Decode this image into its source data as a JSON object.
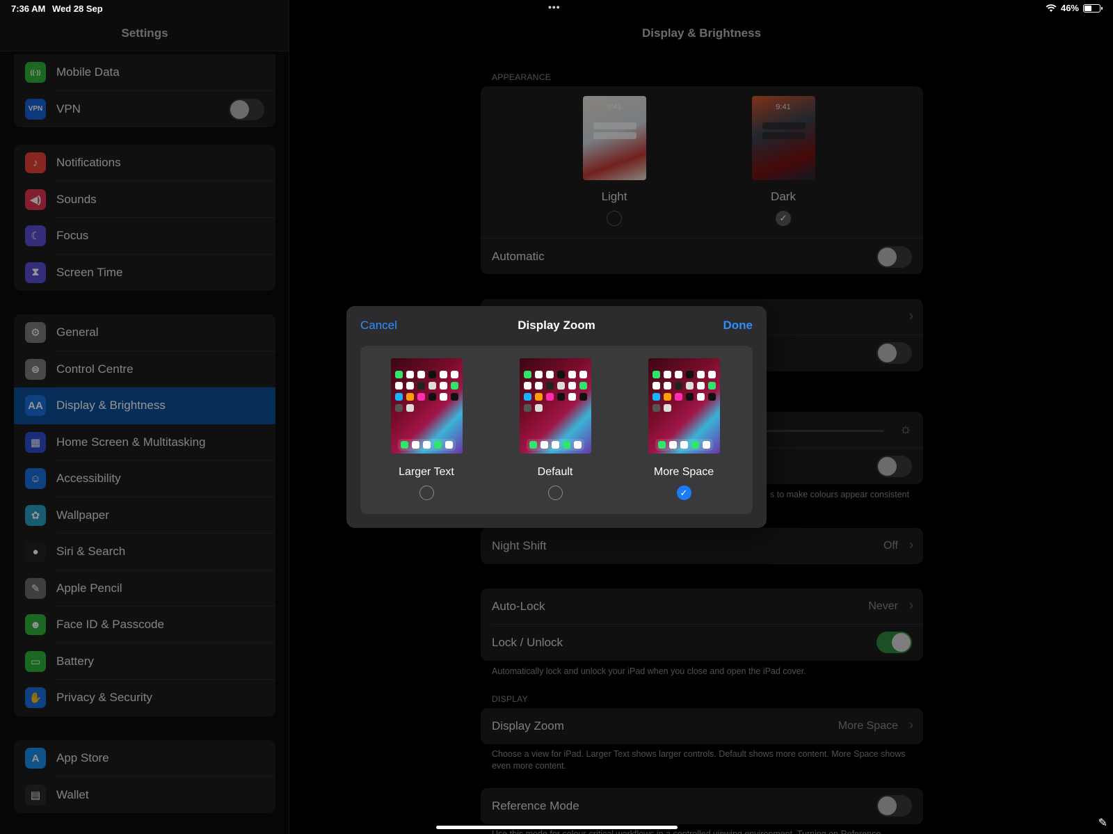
{
  "status": {
    "time": "7:36 AM",
    "date": "Wed 28 Sep",
    "battery": "46%",
    "battery_level": 0.46
  },
  "sidebar": {
    "title": "Settings",
    "groups": [
      [
        {
          "label": "Mobile Data",
          "icon": "antenna-icon",
          "color": "#30b33c"
        },
        {
          "label": "VPN",
          "icon": "vpn-icon",
          "color": "#1863d6",
          "toggle": false
        }
      ],
      [
        {
          "label": "Notifications",
          "icon": "bell-icon",
          "color": "#e8413a"
        },
        {
          "label": "Sounds",
          "icon": "speaker-icon",
          "color": "#e23552"
        },
        {
          "label": "Focus",
          "icon": "moon-icon",
          "color": "#5b4fd3"
        },
        {
          "label": "Screen Time",
          "icon": "hourglass-icon",
          "color": "#5b4fd3"
        }
      ],
      [
        {
          "label": "General",
          "icon": "gear-icon",
          "color": "#7d7d82"
        },
        {
          "label": "Control Centre",
          "icon": "switches-icon",
          "color": "#7d7d82"
        },
        {
          "label": "Display & Brightness",
          "icon": "text-size-icon",
          "color": "#1a6fe0",
          "selected": true
        },
        {
          "label": "Home Screen & Multitasking",
          "icon": "grid-icon",
          "color": "#2f4fd1"
        },
        {
          "label": "Accessibility",
          "icon": "accessibility-icon",
          "color": "#1a6fe0"
        },
        {
          "label": "Wallpaper",
          "icon": "flower-icon",
          "color": "#2a9fbf"
        },
        {
          "label": "Siri & Search",
          "icon": "siri-icon",
          "color": "#222"
        },
        {
          "label": "Apple Pencil",
          "icon": "pencil-icon",
          "color": "#6b6b70"
        },
        {
          "label": "Face ID & Passcode",
          "icon": "face-id-icon",
          "color": "#30b33c"
        },
        {
          "label": "Battery",
          "icon": "battery-icon",
          "color": "#30b33c"
        },
        {
          "label": "Privacy & Security",
          "icon": "hand-icon",
          "color": "#1a6fe0"
        }
      ],
      [
        {
          "label": "App Store",
          "icon": "app-store-icon",
          "color": "#1a8ff0"
        },
        {
          "label": "Wallet",
          "icon": "wallet-icon",
          "color": "#2b2b2b"
        }
      ]
    ]
  },
  "main": {
    "title": "Display & Brightness",
    "appearance_header": "APPEARANCE",
    "appearance": {
      "light_label": "Light",
      "dark_label": "Dark",
      "thumb_time": "9:41",
      "selected": "Dark",
      "automatic_label": "Automatic",
      "automatic_on": false
    },
    "true_tone_note_fragment": "s to make colours appear consistent",
    "night_shift": {
      "label": "Night Shift",
      "value": "Off"
    },
    "auto_lock": {
      "label": "Auto-Lock",
      "value": "Never"
    },
    "lock_unlock": {
      "label": "Lock / Unlock",
      "on": true
    },
    "lock_note": "Automatically lock and unlock your iPad when you close and open the iPad cover.",
    "display_header": "DISPLAY",
    "display_zoom": {
      "label": "Display Zoom",
      "value": "More Space"
    },
    "zoom_note": "Choose a view for iPad. Larger Text shows larger controls. Default shows more content. More Space shows even more content.",
    "reference_mode": {
      "label": "Reference Mode",
      "on": false
    },
    "reference_note": "Use this mode for colour-critical workflows in a controlled viewing environment. Turning on Reference"
  },
  "modal": {
    "cancel": "Cancel",
    "title": "Display Zoom",
    "done": "Done",
    "options": [
      {
        "label": "Larger Text",
        "checked": false
      },
      {
        "label": "Default",
        "checked": false
      },
      {
        "label": "More Space",
        "checked": true
      }
    ]
  },
  "colors": {
    "accent": "#2f8fff",
    "selected_row": "#0a4f97",
    "toggle_on": "#2f8a3c"
  }
}
